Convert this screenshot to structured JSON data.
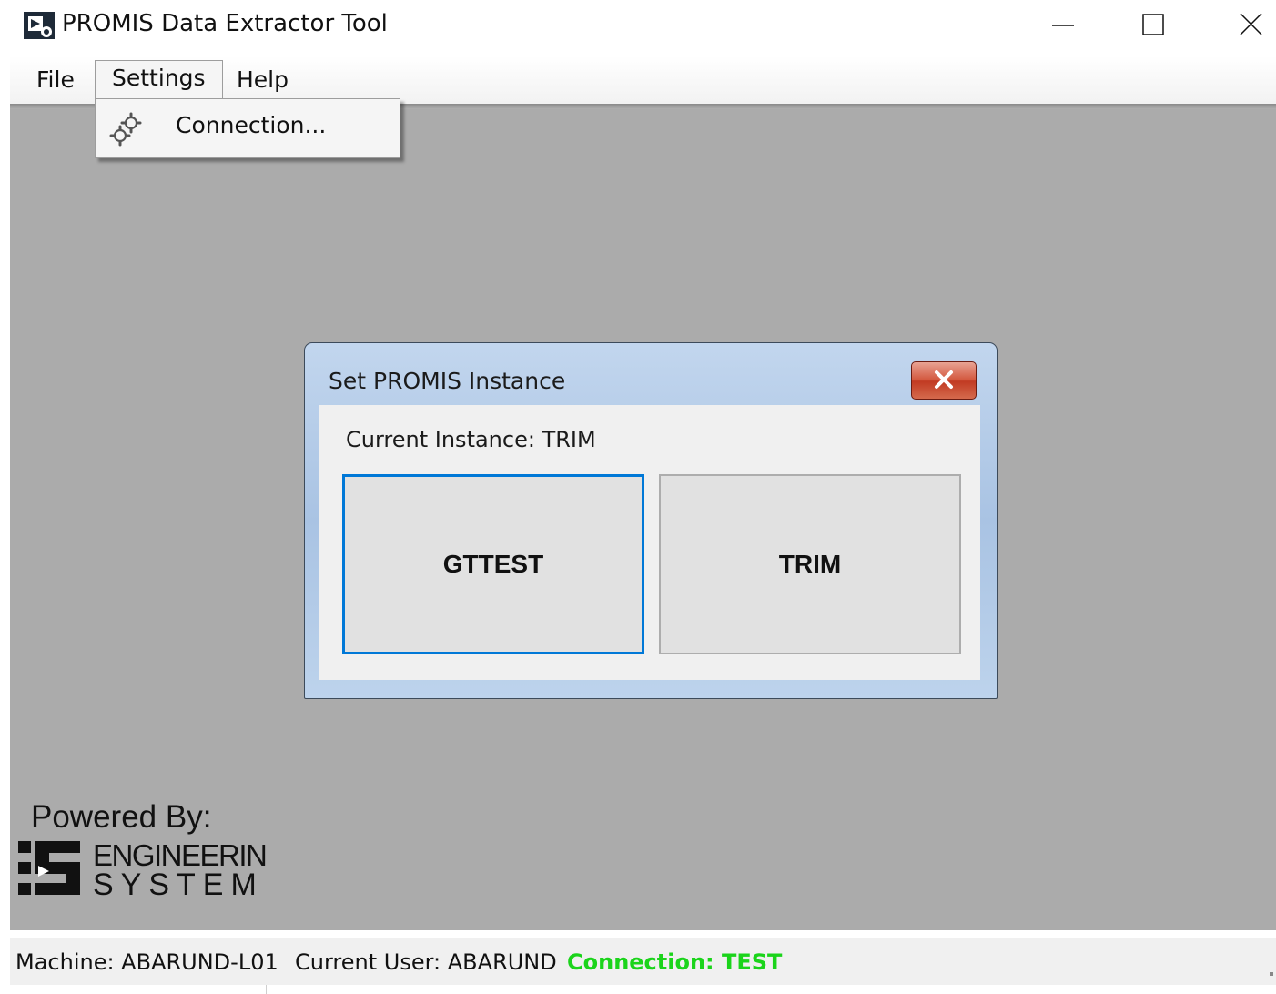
{
  "window": {
    "title": "PROMIS Data Extractor Tool"
  },
  "menubar": {
    "items": [
      {
        "label": "File"
      },
      {
        "label": "Settings"
      },
      {
        "label": "Help"
      }
    ]
  },
  "settings_menu": {
    "items": [
      {
        "label": "Connection...",
        "icon": "gears-icon"
      }
    ]
  },
  "dialog": {
    "title": "Set PROMIS Instance",
    "current_instance": "Current Instance: TRIM",
    "buttons": [
      {
        "label": "GTTEST",
        "focused": true
      },
      {
        "label": "TRIM",
        "focused": false
      }
    ]
  },
  "branding": {
    "powered_by": "Powered By:",
    "logo_line1": "ENGINEERIN",
    "logo_line2": "SYSTEM"
  },
  "statusbar": {
    "machine": "Machine: ABARUND-L01",
    "user": "Current User: ABARUND",
    "connection": "Connection: TEST",
    "connection_color": "#1bd41b"
  }
}
